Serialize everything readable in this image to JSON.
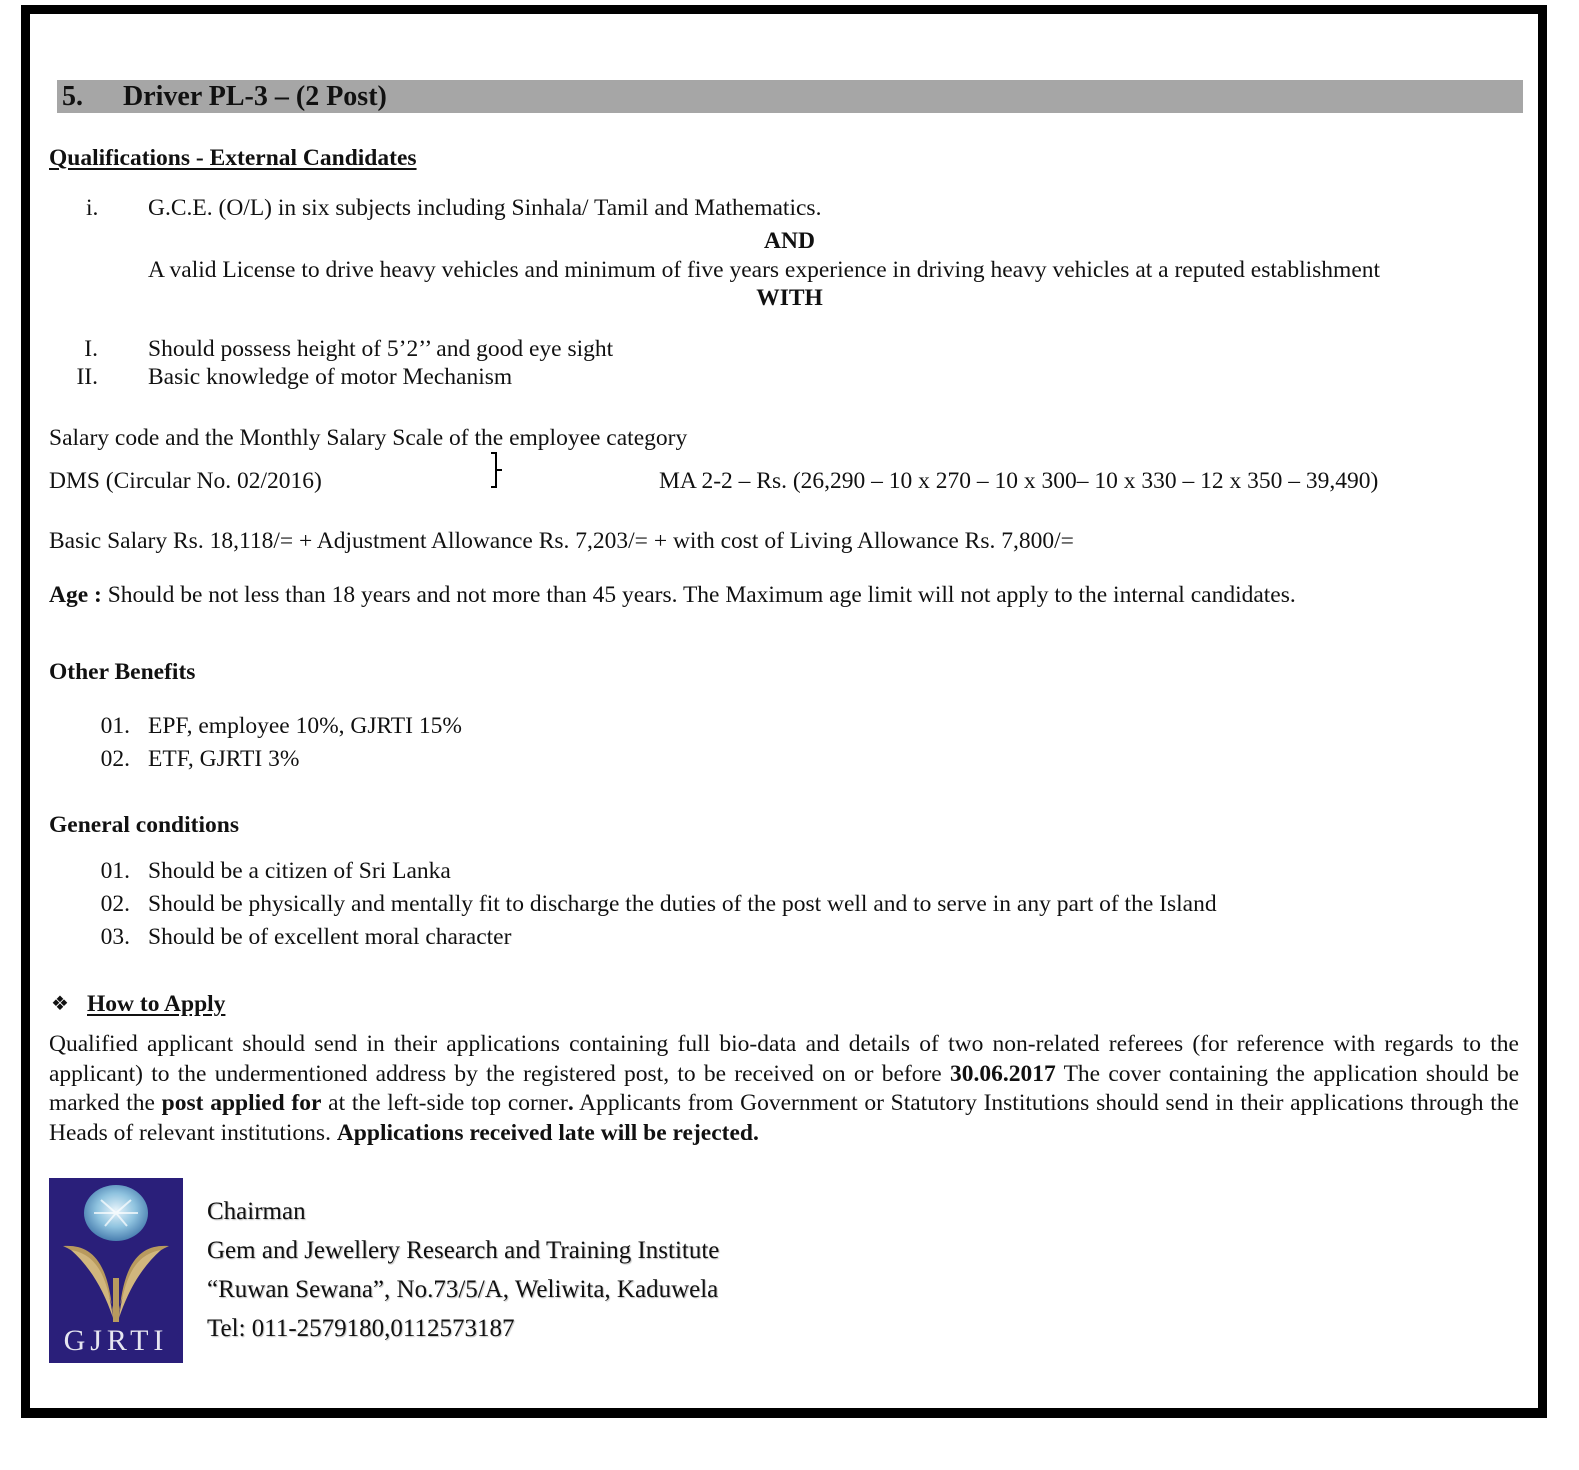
{
  "section": {
    "number": "5.",
    "title": "Driver PL-3 – (2 Post)",
    "title_bar_color": "#a6a6a6"
  },
  "qualifications": {
    "heading": "Qualifications - External Candidates",
    "items": [
      {
        "marker": "i.",
        "text": "G.C.E. (O/L) in six subjects including Sinhala/ Tamil and Mathematics."
      }
    ],
    "connector_and": "AND",
    "license_text": "A valid License to drive heavy vehicles and minimum of five years experience in driving heavy vehicles at a reputed establishment",
    "connector_with": "WITH",
    "additional": [
      {
        "marker": "I.",
        "text": "Should possess height of 5’2’’ and good eye sight"
      },
      {
        "marker": "II.",
        "text": "Basic knowledge of motor Mechanism"
      }
    ]
  },
  "salary": {
    "heading": "Salary code and the Monthly Salary Scale of the employee category",
    "code": "DMS (Circular No. 02/2016)",
    "scale": "MA 2-2 – Rs. (26,290 – 10 x 270 – 10 x 300– 10 x 330 – 12 x 350 – 39,490)",
    "breakdown": "Basic Salary Rs. 18,118/= + Adjustment Allowance Rs. 7,203/= + with cost of Living Allowance Rs. 7,800/="
  },
  "age": {
    "label": "Age :",
    "text": " Should be not less than 18 years and not more than 45 years. The Maximum age limit will not apply to the internal candidates."
  },
  "other_benefits": {
    "heading": "Other Benefits",
    "items": [
      {
        "marker": "01.",
        "text": "EPF, employee 10%, GJRTI 15%"
      },
      {
        "marker": "02.",
        "text": "ETF, GJRTI 3%"
      }
    ]
  },
  "general_conditions": {
    "heading": "General conditions",
    "items": [
      {
        "marker": "01.",
        "text": "Should be a citizen of Sri Lanka"
      },
      {
        "marker": "02.",
        "text": "Should be physically and mentally fit to discharge the duties of the post well and to serve in any part of the Island"
      },
      {
        "marker": "03.",
        "text": "Should be of excellent moral character"
      }
    ]
  },
  "how_to_apply": {
    "bullet_icon": "❖",
    "heading": "How to Apply",
    "p1": "Qualified applicant should send in their applications containing full bio-data and details of two non-related referees (for reference with regards to the applicant) to the undermentioned address by the registered post, to be received on or before ",
    "deadline": "30.06.2017",
    "p2": " The cover containing the application should be marked the ",
    "post_applied_for": "post applied for",
    "p3": " at the left-side top corner",
    "p3_dot": ".",
    "p4": " Applicants from Government or Statutory Institutions should send in their applications through the Heads of relevant institutions. ",
    "warning": "Applications received late will be rejected."
  },
  "contact": {
    "logo_text": "GJRTI",
    "logo_bg_color": "#2a1f7a",
    "logo_gold_color": "#b89a5e",
    "lines": [
      "Chairman",
      "Gem and Jewellery Research and Training Institute",
      "“Ruwan Sewana”, No.73/5/A, Weliwita, Kaduwela",
      "Tel: 011-2579180,0112573187"
    ]
  }
}
